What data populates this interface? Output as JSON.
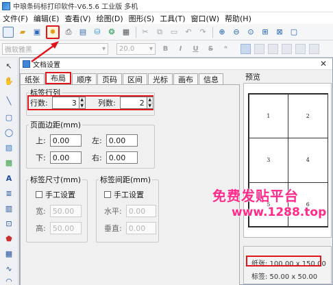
{
  "window": {
    "title": "中琅条码标打印软件-V6.5.6 工业版 多机"
  },
  "menu": [
    "文件(F)",
    "编辑(E)",
    "查看(V)",
    "绘图(D)",
    "图形(S)",
    "工具(T)",
    "窗口(W)",
    "帮助(H)"
  ],
  "format_bar": {
    "font": "微软雅黑",
    "size": "20.0",
    "bold": "B",
    "italic": "I",
    "underline": "U",
    "strike": "S",
    "sub": "ⁿ"
  },
  "dialog": {
    "title": "文档设置",
    "close": "✕",
    "tabs": [
      "纸张",
      "布局",
      "顺序",
      "页码",
      "区间",
      "光标",
      "画布",
      "信息"
    ],
    "active_tab": "布局",
    "layout": {
      "rows_cols": {
        "legend": "标签行列",
        "rows_label": "行数:",
        "rows_value": "3",
        "cols_label": "列数:",
        "cols_value": "2"
      },
      "margins": {
        "legend": "页面边距(mm)",
        "top_label": "上:",
        "top": "0.00",
        "left_label": "左:",
        "left": "0.00",
        "bottom_label": "下:",
        "bottom": "0.00",
        "right_label": "右:",
        "right": "0.00"
      },
      "size": {
        "legend": "标签尺寸(mm)",
        "manual": "手工设置",
        "width_label": "宽:",
        "width": "50.00",
        "height_label": "高:",
        "height": "50.00"
      },
      "spacing": {
        "legend": "标签间距(mm)",
        "manual": "手工设置",
        "h_label": "水平:",
        "h": "0.00",
        "v_label": "垂直:",
        "v": "0.00"
      }
    },
    "preview": {
      "label": "预览",
      "cells": [
        "1",
        "2",
        "3",
        "4",
        "5",
        "6"
      ],
      "paper_line": "纸张: 100.00 x 150.00",
      "label_line": "标签: 50.00 x 50.00"
    }
  },
  "watermark": {
    "line1": "免费发贴平台",
    "line2": "www.1288.top"
  },
  "colors": {
    "highlight": "#e0141b",
    "watermark": "#ff2a8a"
  }
}
